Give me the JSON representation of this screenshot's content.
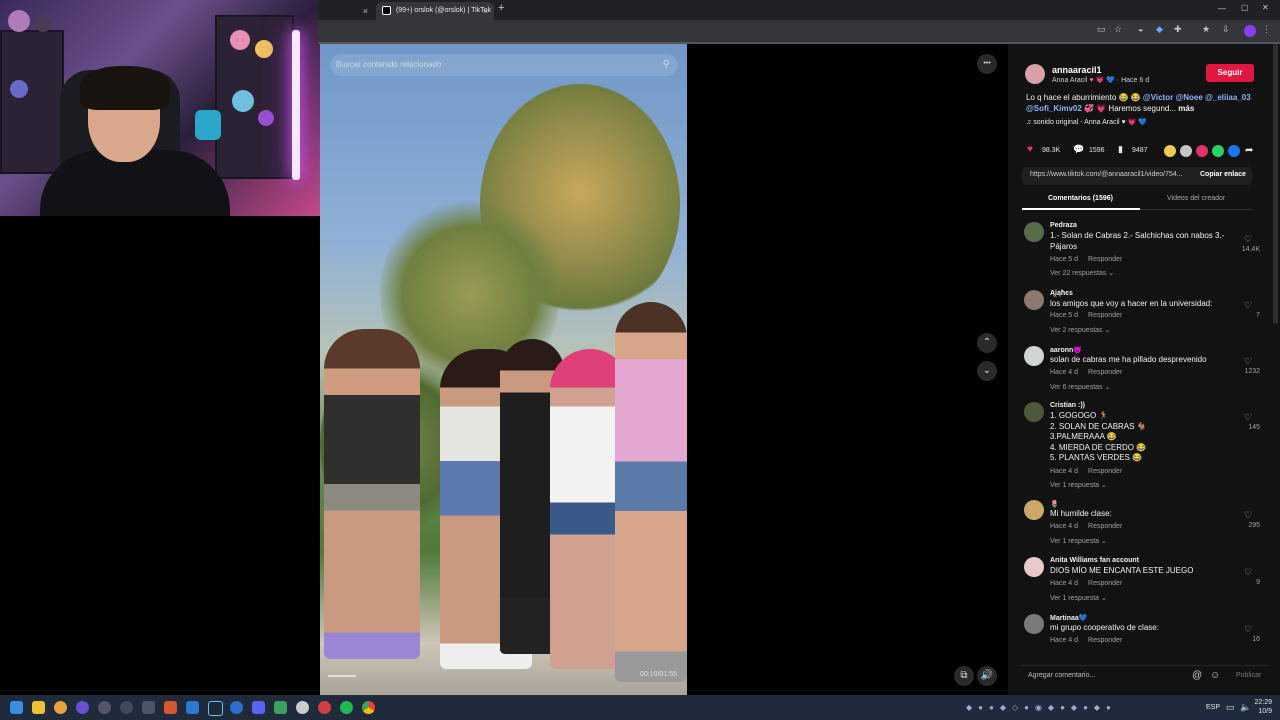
{
  "browser": {
    "tabs": [
      {
        "label": "",
        "active": false
      },
      {
        "label": "(99+) orslok (@orslok) | TikTok",
        "active": true
      }
    ],
    "new_tab_symbol": "+",
    "window_controls": [
      "—",
      "▢",
      "✕"
    ]
  },
  "video": {
    "search_placeholder": "Buscar contenido relacionado",
    "timecode": "00:10/01:55",
    "more_symbol": "•••"
  },
  "post": {
    "username": "annaaracil1",
    "display_name": "Anna Aracil",
    "display_name_emoji": "♥ 💗 💙",
    "time_ago": "· Hace 6 d",
    "follow_label": "Seguir",
    "caption_start": "Lo q hace el aburrimiento 😂 😂",
    "mention_1": "@Victor",
    "mention_2": "@Noee",
    "mention_3": "@_eliiaa_03",
    "mention_4": "@Sofi_Kimv02",
    "caption_end": "💞 💗 Haremos segund...",
    "more_label": "más",
    "sound": "sonido original - Anna Aracil ♥ 💗 💙",
    "likes": "98.3K",
    "comments": "1596",
    "saves": "9487",
    "link": "https://www.tiktok.com/@annaaracil1/video/754...",
    "copy_link_label": "Copiar enlace",
    "tab_comments": "Comentarios (1596)",
    "tab_creator_videos": "Videos del creador"
  },
  "comments": [
    {
      "name": "Pedraza",
      "text": "1.- Solan de Cabras 2.- Salchichas con nabos 3.-\nPájaros",
      "date": "Hace 5 d",
      "reply_label": "Responder",
      "replies": "Ver 22 respuestas ⌄",
      "likes": "14.4K",
      "avatar_color": "#5a6b4a"
    },
    {
      "name": "Ąįąħєѕ",
      "text": "los amigos que voy a hacer en la universidad:",
      "date": "Hace 5 d",
      "reply_label": "Responder",
      "replies": "Ver 2 respuestas ⌄",
      "likes": "7",
      "avatar_color": "#8c7a6a"
    },
    {
      "name": "aaronn😈",
      "text": "solan de cabras me ha pillado desprevenido",
      "date": "Hace 4 d",
      "reply_label": "Responder",
      "replies": "Ver 6 respuestas ⌄",
      "likes": "1232",
      "avatar_color": "#cfd6cf"
    },
    {
      "name": "Cristian :))",
      "text": "1. GOGOGO 🏃\n2. SOLAN DE CABRAS 🐐\n3.PALMERAAA 😂\n4. MIERDA DE CERDO 😂\n5. PLANTAS VERDES 😂",
      "date": "Hace 4 d",
      "reply_label": "Responder",
      "replies": "Ver 1 respuesta ⌄",
      "likes": "145",
      "avatar_color": "#4a5a3a"
    },
    {
      "name": "🌷",
      "text": "Mi humilde clase:",
      "date": "Hace 4 d",
      "reply_label": "Responder",
      "replies": "Ver 1 respuesta ⌄",
      "likes": "295",
      "avatar_color": "#c9a86a"
    },
    {
      "name": "Anita Williams fan account",
      "text": "DIOS MÍO ME ENCANTA ESTE JUEGO",
      "date": "Hace 4 d",
      "reply_label": "Responder",
      "replies": "Ver 1 respuesta ⌄",
      "likes": "9",
      "avatar_color": "#e8c8c8"
    },
    {
      "name": "Martinaa💙",
      "text": "mi grupo cooperativo de clase:",
      "date": "Hace 4 d",
      "reply_label": "Responder",
      "replies": "",
      "likes": "16",
      "avatar_color": "#7a7a7a"
    }
  ],
  "composer": {
    "placeholder": "Agregar comentario...",
    "publish_label": "Publicar"
  },
  "taskbar": {
    "lang": "ESP",
    "time": "22:29",
    "date": "10/9"
  }
}
